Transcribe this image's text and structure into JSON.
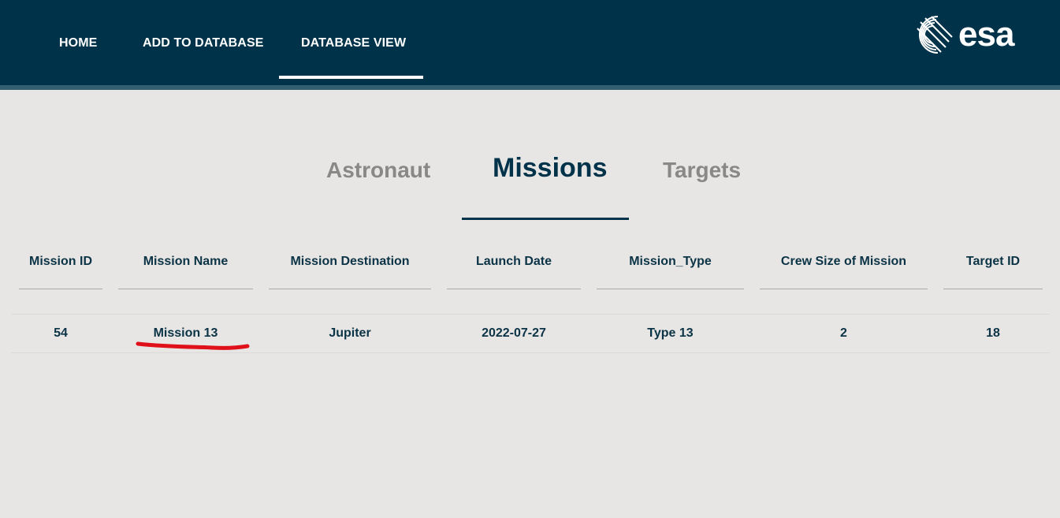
{
  "nav": {
    "home": "HOME",
    "add": "ADD TO DATABASE",
    "view": "DATABASE VIEW"
  },
  "logo": {
    "text": "esa",
    "icon": "esa-logo-icon"
  },
  "tabs": {
    "astronaut": "Astronaut",
    "missions": "Missions",
    "targets": "Targets",
    "active": "Missions"
  },
  "table": {
    "headers": [
      "Mission ID",
      "Mission Name",
      "Mission Destination",
      "Launch Date",
      "Mission_Type",
      "Crew Size of Mission",
      "Target ID"
    ],
    "rows": [
      [
        "54",
        "Mission 13",
        "Jupiter",
        "2022-07-27",
        "Type 13",
        "2",
        "18"
      ]
    ]
  },
  "colors": {
    "header_bg": "#003249",
    "page_bg": "#e8e6e4",
    "annotation": "#e0101a"
  }
}
